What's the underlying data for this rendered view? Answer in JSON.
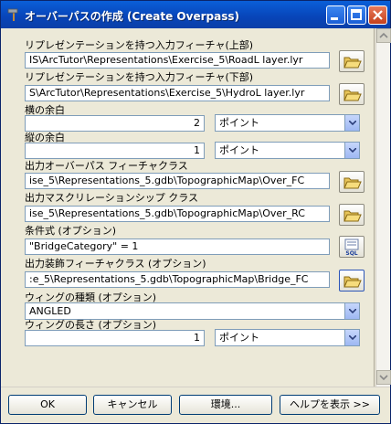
{
  "window": {
    "title": "オーバーパスの作成 (Create Overpass)"
  },
  "fields": {
    "upper_label": "リプレゼンテーションを持つ入力フィーチャ(上部)",
    "upper_value": "IS\\ArcTutor\\Representations\\Exercise_5\\RoadL layer.lyr",
    "lower_label": "リプレゼンテーションを持つ入力フィーチャ(下部)",
    "lower_value": "S\\ArcTutor\\Representations\\Exercise_5\\HydroL layer.lyr",
    "margin_along_label": "横の余白",
    "margin_along_value": "2",
    "margin_along_unit": "ポイント",
    "margin_across_label": "縦の余白",
    "margin_across_value": "1",
    "margin_across_unit": "ポイント",
    "out_overpass_label": "出力オーバーパス フィーチャクラス",
    "out_overpass_value": "ise_5\\Representations_5.gdb\\TopographicMap\\Over_FC",
    "out_mask_label": "出力マスクリレーションシップ クラス",
    "out_mask_value": "ise_5\\Representations_5.gdb\\TopographicMap\\Over_RC",
    "where_label": "条件式 (オプション)",
    "where_value": "\"BridgeCategory\" = 1",
    "out_decoration_label": "出力装飾フィーチャクラス (オプション)",
    "out_decoration_value": ":e_5\\Representations_5.gdb\\TopographicMap\\Bridge_FC",
    "wing_type_label": "ウィングの種類 (オプション)",
    "wing_type_value": "ANGLED",
    "wing_length_label": "ウィングの長さ (オプション)",
    "wing_length_value": "1",
    "wing_length_unit": "ポイント"
  },
  "icons": {
    "browse": "folder-open-icon",
    "sql": "sql-icon",
    "title": "hammer-icon"
  },
  "buttons": {
    "ok": "OK",
    "cancel": "キャンセル",
    "environments": "環境...",
    "help": "ヘルプを表示 >>"
  },
  "sql_icon_text": "SQL"
}
